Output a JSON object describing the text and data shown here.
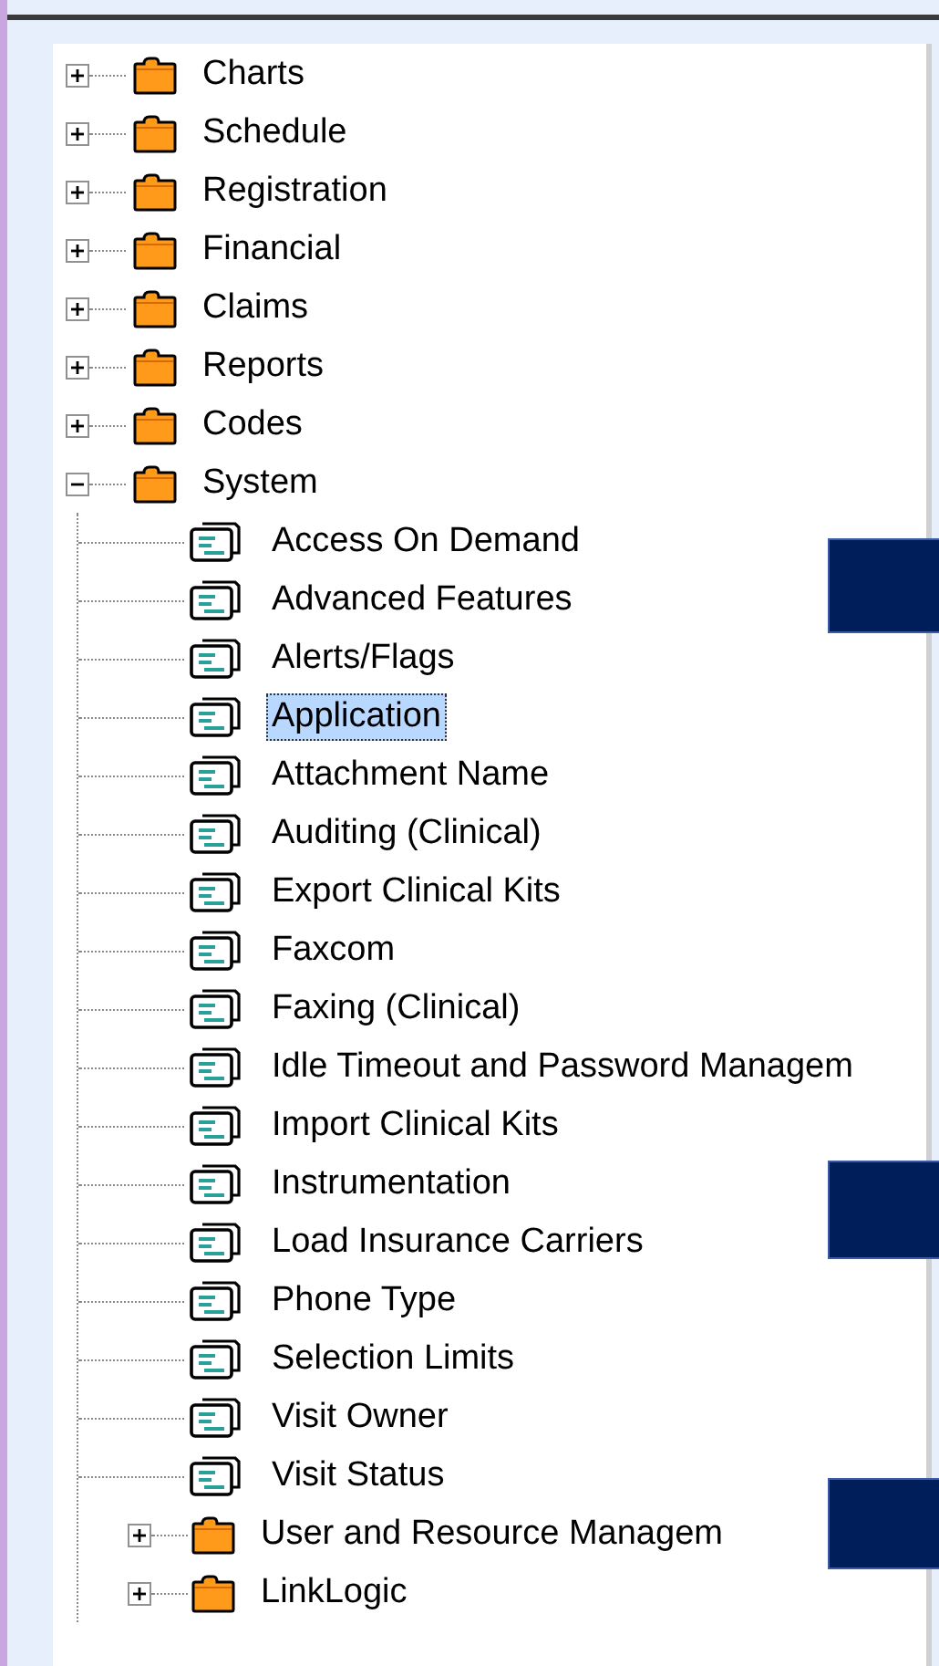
{
  "tree": [
    {
      "kind": "folder",
      "label": "Charts",
      "expanded": false,
      "selected": false
    },
    {
      "kind": "folder",
      "label": "Schedule",
      "expanded": false,
      "selected": false
    },
    {
      "kind": "folder",
      "label": "Registration",
      "expanded": false,
      "selected": false
    },
    {
      "kind": "folder",
      "label": "Financial",
      "expanded": false,
      "selected": false
    },
    {
      "kind": "folder",
      "label": "Claims",
      "expanded": false,
      "selected": false
    },
    {
      "kind": "folder",
      "label": "Reports",
      "expanded": false,
      "selected": false
    },
    {
      "kind": "folder",
      "label": "Codes",
      "expanded": false,
      "selected": false
    },
    {
      "kind": "folder",
      "label": "System",
      "expanded": true,
      "selected": false,
      "children": [
        {
          "kind": "document",
          "label": "Access On Demand",
          "selected": false
        },
        {
          "kind": "document",
          "label": "Advanced Features",
          "selected": false
        },
        {
          "kind": "document",
          "label": "Alerts/Flags",
          "selected": false
        },
        {
          "kind": "document",
          "label": "Application",
          "selected": true
        },
        {
          "kind": "document",
          "label": "Attachment Name",
          "selected": false
        },
        {
          "kind": "document",
          "label": "Auditing (Clinical)",
          "selected": false
        },
        {
          "kind": "document",
          "label": "Export Clinical Kits",
          "selected": false
        },
        {
          "kind": "document",
          "label": "Faxcom",
          "selected": false
        },
        {
          "kind": "document",
          "label": "Faxing (Clinical)",
          "selected": false
        },
        {
          "kind": "document",
          "label": "Idle Timeout and Password Managem",
          "selected": false
        },
        {
          "kind": "document",
          "label": "Import Clinical Kits",
          "selected": false
        },
        {
          "kind": "document",
          "label": "Instrumentation",
          "selected": false
        },
        {
          "kind": "document",
          "label": "Load Insurance Carriers",
          "selected": false
        },
        {
          "kind": "document",
          "label": "Phone Type",
          "selected": false
        },
        {
          "kind": "document",
          "label": "Selection Limits",
          "selected": false
        },
        {
          "kind": "document",
          "label": "Visit Owner",
          "selected": false
        },
        {
          "kind": "document",
          "label": "Visit Status",
          "selected": false
        },
        {
          "kind": "folder",
          "label": "User and Resource Managem",
          "expanded": false,
          "selected": false
        },
        {
          "kind": "folder",
          "label": "LinkLogic",
          "expanded": false,
          "selected": false
        }
      ]
    }
  ]
}
